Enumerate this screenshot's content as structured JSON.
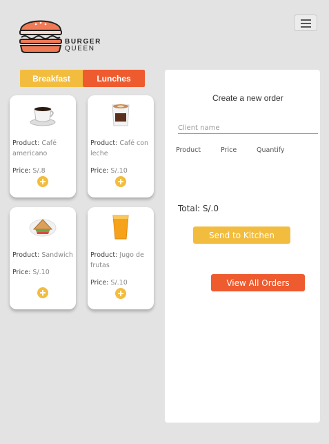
{
  "brand": {
    "line1": "BURGER",
    "line2": "QUEEN"
  },
  "tabs": {
    "breakfast": "Breakfast",
    "lunches": "Lunches"
  },
  "product_label": "Product:",
  "price_label": "Price:",
  "products": [
    {
      "name": "Café americano",
      "price": "S/.8",
      "icon": "coffee-cup-icon"
    },
    {
      "name": "Café con leche",
      "price": "S/.10",
      "icon": "latte-cup-icon"
    },
    {
      "name": "Sandwich",
      "price": "S/.10",
      "icon": "sandwich-icon"
    },
    {
      "name": "Jugo de frutas",
      "price": "S/.10",
      "icon": "juice-glass-icon"
    }
  ],
  "order": {
    "title": "Create a new order",
    "client_placeholder": "Client name",
    "columns": [
      "Product",
      "Price",
      "Quantify"
    ],
    "total": "Total: S/.0",
    "send_button": "Send to Kitchen",
    "view_button": "View All Orders"
  },
  "colors": {
    "yellow": "#f2bd3f",
    "orange": "#ee5b2f",
    "background": "#e3e3e3"
  }
}
